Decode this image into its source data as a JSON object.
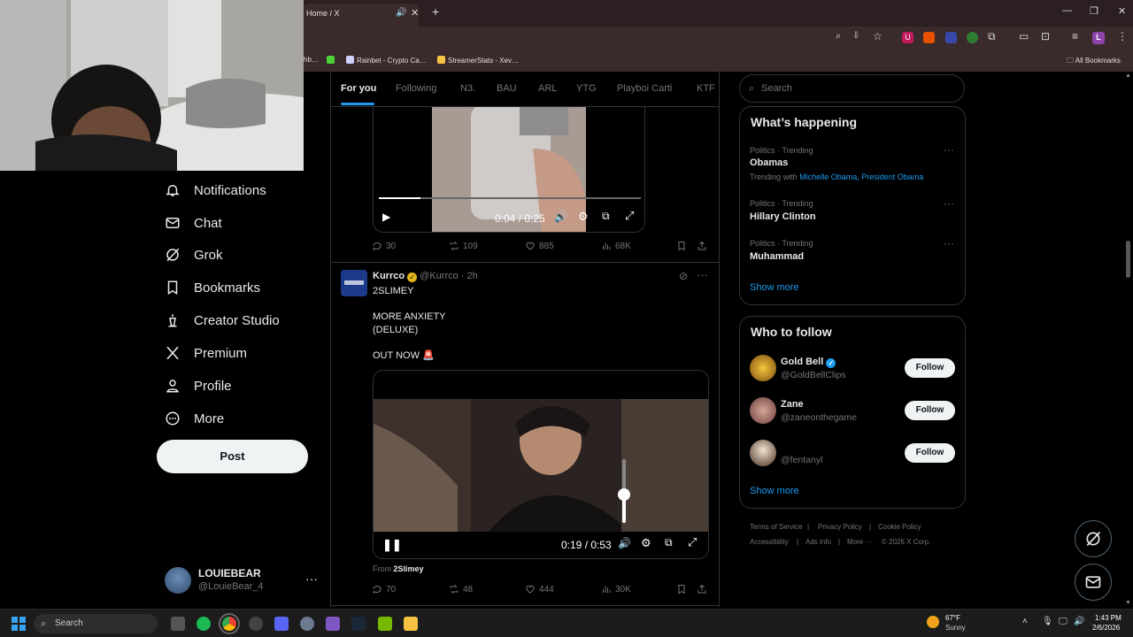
{
  "browser": {
    "tab_title": "Home / X",
    "tab_audio_icon": "speaker-icon",
    "bookmarks": [
      {
        "label": "hb…",
        "color": "#888888"
      },
      {
        "label": "",
        "color": "#4cd137"
      },
      {
        "label": "Rainbet - Crypto Ca…",
        "color": "#d0d0ff"
      },
      {
        "label": "StreamerStats - Xev…",
        "color": "#f6c344"
      }
    ],
    "all_bookmarks_label": "All Bookmarks",
    "profile_letter": "L"
  },
  "sidebar": {
    "items": [
      {
        "label": "Notifications",
        "icon": "bell-icon"
      },
      {
        "label": "Chat",
        "icon": "mail-icon"
      },
      {
        "label": "Grok",
        "icon": "grok-icon"
      },
      {
        "label": "Bookmarks",
        "icon": "bookmark-icon"
      },
      {
        "label": "Creator Studio",
        "icon": "creator-studio-icon"
      },
      {
        "label": "Premium",
        "icon": "x-logo-icon"
      },
      {
        "label": "Profile",
        "icon": "person-icon"
      },
      {
        "label": "More",
        "icon": "more-circle-icon"
      }
    ],
    "post_label": "Post",
    "account": {
      "name": "LOUIEBEAR",
      "handle": "@LouieBear_4"
    }
  },
  "feed": {
    "tabs": [
      "For you",
      "Following",
      "N3.",
      "BAU",
      "ARL",
      "YTG",
      "Playboi Carti",
      "KTF"
    ],
    "active_tab": "For you",
    "post1": {
      "video_time": "0:04 / 0:25",
      "video_progress": 0.16,
      "stats": {
        "replies": "30",
        "reposts": "109",
        "likes": "885",
        "views": "68K"
      }
    },
    "post2": {
      "author": "Kurrco",
      "handle": "@Kurrco",
      "time": "· 2h",
      "text_line1": "2SLIMEY",
      "text_line2": "MORE ANXIETY",
      "text_line3": "(DELUXE)",
      "text_line4": "OUT NOW 🚨",
      "video_time": "0:19 / 0:53",
      "volume_level": 0.45,
      "from_prefix": "From",
      "from_name": "2Slimey",
      "stats": {
        "replies": "70",
        "reposts": "48",
        "likes": "444",
        "views": "30K"
      }
    }
  },
  "right": {
    "search_placeholder": "Search",
    "whats_happening": {
      "title": "What’s happening",
      "trends": [
        {
          "meta": "Politics · Trending",
          "name": "Obamas",
          "with_prefix": "Trending with",
          "with": "Michelle Obama, President Obama"
        },
        {
          "meta": "Politics · Trending",
          "name": "Hillary Clinton"
        },
        {
          "meta": "Politics · Trending",
          "name": "Muhammad"
        }
      ],
      "show_more": "Show more"
    },
    "who_to_follow": {
      "title": "Who to follow",
      "users": [
        {
          "name": "Gold Bell",
          "handle": "@GoldBellClips",
          "verified": true,
          "follow": "Follow"
        },
        {
          "name": "Zane",
          "handle": "@zaneonthegame",
          "follow": "Follow"
        },
        {
          "name": "",
          "handle": "@fentanyl",
          "follow": "Follow"
        }
      ],
      "show_more": "Show more"
    },
    "footer": {
      "terms": "Terms of Service",
      "privacy": "Privacy Policy",
      "cookie": "Cookie Policy",
      "accessibility": "Accessibility",
      "ads": "Ads info",
      "more": "More ···",
      "copyright": "© 2026 X Corp."
    }
  },
  "taskbar": {
    "search_label": "Search",
    "weather_temp": "67°F",
    "weather_desc": "Sunny",
    "time": "1:43 PM",
    "date": "2/6/2026"
  }
}
